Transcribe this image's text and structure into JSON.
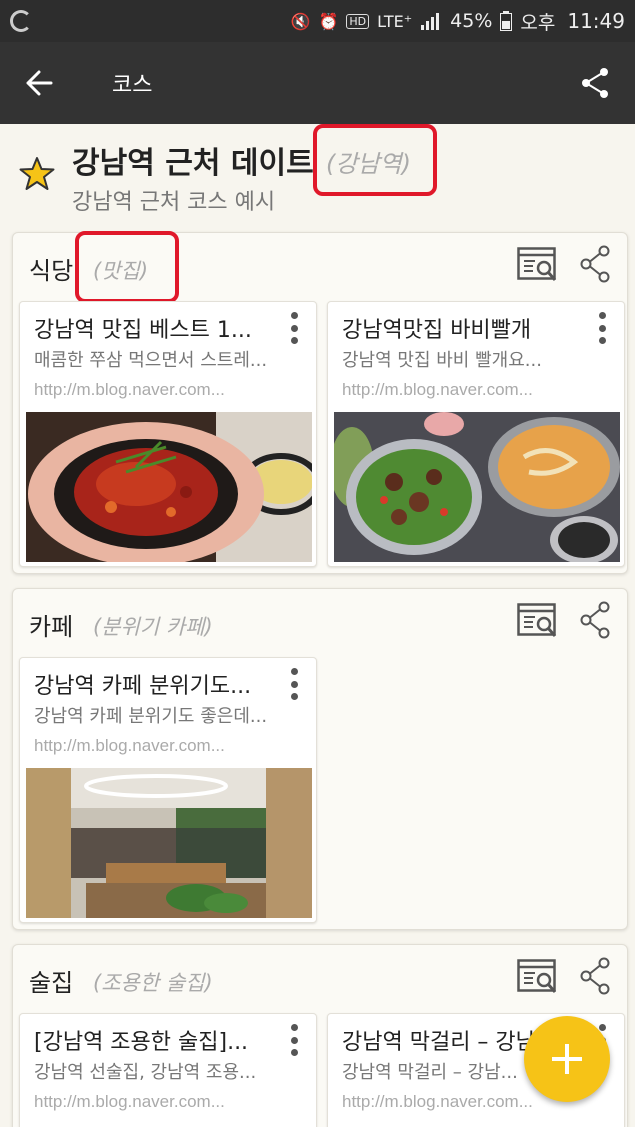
{
  "status_bar": {
    "lte": "LTE⁺",
    "battery": "45%",
    "ampm": "오후",
    "time": "11:49"
  },
  "app_bar": {
    "title": "코스"
  },
  "course": {
    "title": "강남역 근처 데이트",
    "location_tag": "(강남역)",
    "subtitle": "강남역 근처 코스 예시"
  },
  "sections": [
    {
      "name": "식당",
      "tag": "(맛집)",
      "cards": [
        {
          "title": "강남역 맛집 베스트 1...",
          "desc": "매콤한 쭈삼 먹으면서 스트레...",
          "url": "http://m.blog.naver.com...",
          "image": "spicy-pork-pan-photo"
        },
        {
          "title": "강남역맛집 바비빨개",
          "desc": "강남역 맛집 바비 빨개요...",
          "url": "http://m.blog.naver.com...",
          "image": "steak-salad-photo"
        }
      ]
    },
    {
      "name": "카페",
      "tag": "(분위기 카페)",
      "cards": [
        {
          "title": "강남역 카페 분위기도...",
          "desc": "강남역 카페 분위기도 좋은데...",
          "url": "http://m.blog.naver.com...",
          "image": "cafe-interior-photo"
        }
      ]
    },
    {
      "name": "술집",
      "tag": "(조용한 술집)",
      "cards": [
        {
          "title": "[강남역 조용한 술집]...",
          "desc": "강남역 선술집, 강남역 조용...",
          "url": "http://m.blog.naver.com...",
          "image": "bar-photo"
        },
        {
          "title": "강남역 막걸리 – 강남...",
          "desc": "강남역 막걸리 – 강남...",
          "url": "http://m.blog.naver.com...",
          "image": "makgeolli-photo"
        }
      ]
    }
  ],
  "colors": {
    "accent_yellow": "#f6c317",
    "highlight_red": "#e0182a",
    "app_bar": "#333333"
  }
}
